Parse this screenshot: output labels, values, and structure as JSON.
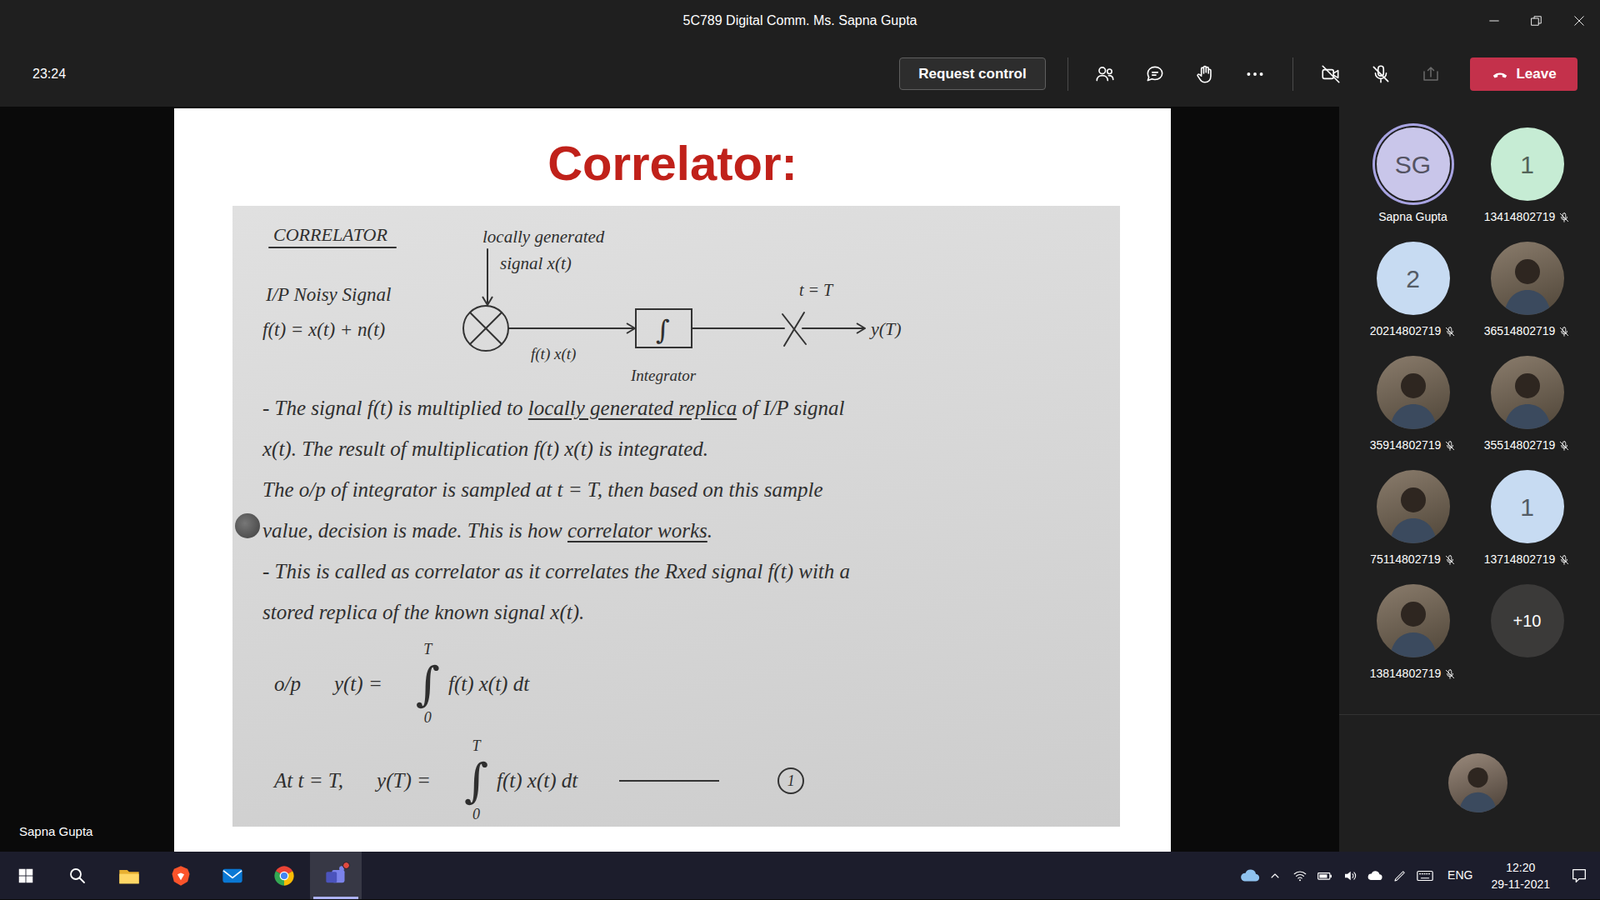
{
  "window": {
    "title": "5C789 Digital Comm. Ms. Sapna Gupta"
  },
  "toolbar": {
    "timer": "23:24",
    "request_control": "Request control",
    "leave": "Leave",
    "camera_on": false,
    "mic_on": false,
    "share_enabled": false
  },
  "stage": {
    "presenter": "Sapna Gupta",
    "slide": {
      "title": "Correlator:",
      "note": {
        "heading": "CORRELATOR",
        "diagram": {
          "local_signal_1": "locally generated",
          "local_signal_2": "signal x(t)",
          "input_label": "I/P Noisy Signal",
          "input_eq": "f(t) = x(t) + n(t)",
          "product": "f(t) x(t)",
          "integral": "∫",
          "integrator": "Integrator",
          "sample_time": "t = T",
          "output": "y(T)"
        },
        "lines": [
          [
            {
              "text": "- The signal f(t) is multiplied to ",
              "underline": false
            },
            {
              "text": "locally generated replica",
              "underline": true
            },
            {
              "text": " of I/P signal",
              "underline": false
            }
          ],
          [
            {
              "text": "x(t). The result of multiplication f(t) x(t) is integrated.",
              "underline": false
            }
          ],
          [
            {
              "text": "The o/p of integrator is sampled at t = T, then based on this sample",
              "underline": false
            }
          ],
          [
            {
              "text": "value, decision is made. This is how ",
              "underline": false
            },
            {
              "text": "correlator works",
              "underline": true
            },
            {
              "text": ".",
              "underline": false
            }
          ],
          [
            {
              "text": "- This is called as correlator as it correlates the Rxed signal f(t) with a",
              "underline": false
            }
          ],
          [
            {
              "text": "stored replica of the known signal x(t).",
              "underline": false
            }
          ]
        ],
        "equations": [
          {
            "lead": "o/p",
            "lhs": "y(t) =",
            "upper": "T",
            "lower": "0",
            "body": "f(t) x(t) dt"
          },
          {
            "lead": "At t = T,",
            "lhs": "y(T) =",
            "upper": "T",
            "lower": "0",
            "body": "f(t) x(t) dt",
            "tag": "1"
          }
        ]
      }
    }
  },
  "participants": [
    {
      "label": "Sapna Gupta",
      "kind": "initials",
      "initials": "SG",
      "color": "#c9c6ea",
      "muted": false,
      "speaking": true
    },
    {
      "label": "13414802719",
      "kind": "initials",
      "initials": "1",
      "color": "#c6ecd4",
      "muted": true,
      "speaking": false
    },
    {
      "label": "20214802719",
      "kind": "initials",
      "initials": "2",
      "color": "#c7dbf2",
      "muted": true,
      "speaking": false
    },
    {
      "label": "36514802719",
      "kind": "photo",
      "muted": true,
      "speaking": false
    },
    {
      "label": "35914802719",
      "kind": "photo",
      "muted": true,
      "speaking": false
    },
    {
      "label": "35514802719",
      "kind": "photo",
      "muted": true,
      "speaking": false
    },
    {
      "label": "75114802719",
      "kind": "photo",
      "muted": true,
      "speaking": false
    },
    {
      "label": "13714802719",
      "kind": "initials",
      "initials": "1",
      "color": "#c7dbf2",
      "muted": true,
      "speaking": false
    },
    {
      "label": "13814802719",
      "kind": "photo",
      "muted": true,
      "speaking": false
    }
  ],
  "overflow": "+10",
  "self_view": {
    "kind": "photo"
  },
  "taskbar": {
    "apps": [
      {
        "kind": "start",
        "active": false,
        "notification": false
      },
      {
        "kind": "search",
        "active": false,
        "notification": false
      },
      {
        "kind": "explorer",
        "active": false,
        "notification": false
      },
      {
        "kind": "brave",
        "active": false,
        "notification": false
      },
      {
        "kind": "mail",
        "active": false,
        "notification": false
      },
      {
        "kind": "chrome",
        "active": false,
        "notification": false
      },
      {
        "kind": "teams",
        "active": true,
        "notification": true
      }
    ],
    "tray": [
      {
        "kind": "weather"
      },
      {
        "kind": "overflow"
      },
      {
        "kind": "wifi"
      },
      {
        "kind": "battery"
      },
      {
        "kind": "volume"
      },
      {
        "kind": "onedrive"
      },
      {
        "kind": "pen"
      },
      {
        "kind": "keyboard"
      }
    ],
    "language": "ENG",
    "time": "12:20",
    "date": "29-11-2021"
  }
}
